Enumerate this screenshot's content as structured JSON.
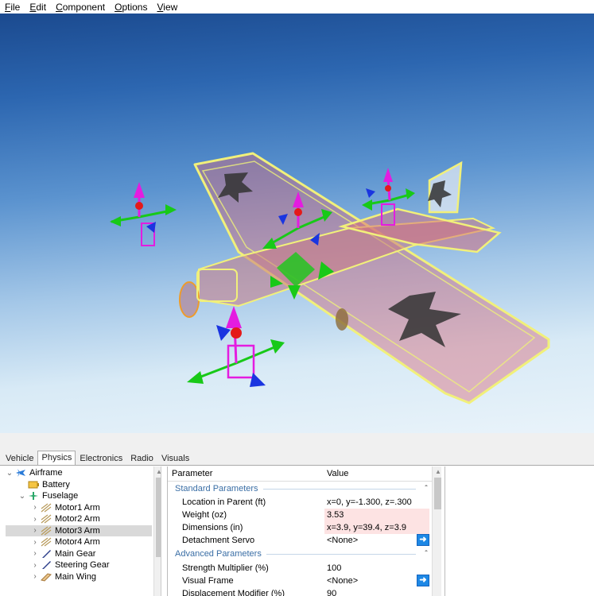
{
  "menu": {
    "file": {
      "first": "F",
      "rest": "ile"
    },
    "edit": {
      "first": "E",
      "rest": "dit"
    },
    "component": {
      "first": "C",
      "rest": "omponent"
    },
    "options": {
      "first": "O",
      "rest": "ptions"
    },
    "view": {
      "first": "V",
      "rest": "iew"
    }
  },
  "tabs": [
    "Vehicle",
    "Physics",
    "Electronics",
    "Radio",
    "Visuals"
  ],
  "active_tab": "Physics",
  "tree": [
    {
      "label": "Airframe",
      "icon": "airplane-icon",
      "expanded": true,
      "level": 0
    },
    {
      "label": "Battery",
      "icon": "battery-icon",
      "level": 1
    },
    {
      "label": "Fuselage",
      "icon": "fuselage-icon",
      "expanded": true,
      "level": 1
    },
    {
      "label": "Motor1 Arm",
      "icon": "arm-icon",
      "level": 2
    },
    {
      "label": "Motor2 Arm",
      "icon": "arm-icon",
      "level": 2
    },
    {
      "label": "Motor3 Arm",
      "icon": "arm-icon",
      "level": 2,
      "selected": true
    },
    {
      "label": "Motor4 Arm",
      "icon": "arm-icon",
      "level": 2
    },
    {
      "label": "Main Gear",
      "icon": "gear-leg-icon",
      "level": 2
    },
    {
      "label": "Steering Gear",
      "icon": "gear-leg-icon",
      "level": 2
    },
    {
      "label": "Main Wing",
      "icon": "wing-icon",
      "level": 2
    }
  ],
  "props": {
    "col_parameter": "Parameter",
    "col_value": "Value",
    "standard_section": "Standard Parameters",
    "advanced_section": "Advanced Parameters",
    "location_label": "Location in Parent (ft)",
    "location_value": "x=0, y=-1.300, z=.300",
    "weight_label": "Weight (oz)",
    "weight_value": "3.53",
    "dimensions_label": "Dimensions (in)",
    "dimensions_value": "x=3.9, y=39.4, z=3.9",
    "detachment_label": "Detachment Servo",
    "detachment_value": "<None>",
    "strength_label": "Strength Multiplier (%)",
    "strength_value": "100",
    "visual_frame_label": "Visual Frame",
    "visual_frame_value": "<None>",
    "displacement_label": "Displacement Modifier (%)",
    "displacement_value": "90"
  },
  "colors": {
    "selection_pink": "#fde3e3",
    "arrow_button": "#1e88e5",
    "section_text": "#3a6ea5"
  }
}
